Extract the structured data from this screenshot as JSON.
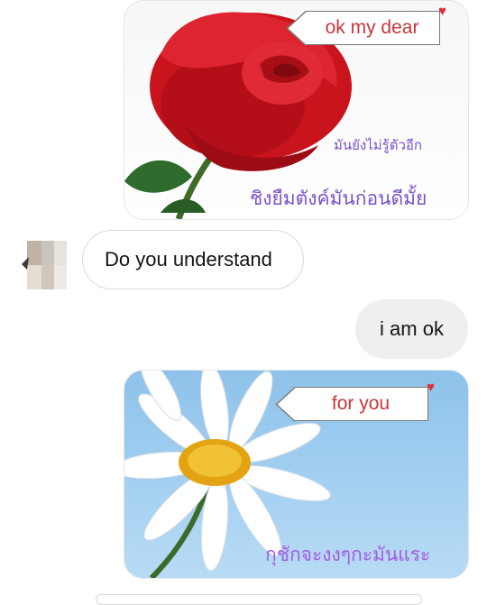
{
  "messages": [
    {
      "type": "sticker",
      "side": "outgoing",
      "image": "red-rose",
      "tag_text": "ok my dear",
      "caption_small": "มันยังไม่รู้ตัวอีก",
      "caption_large": "ชิงยืมตังค์มันก่อนดีมั้ย"
    },
    {
      "type": "text",
      "side": "incoming",
      "text": "Do you understand"
    },
    {
      "type": "text",
      "side": "outgoing",
      "text": "i am ok"
    },
    {
      "type": "sticker",
      "side": "outgoing",
      "image": "white-daisy",
      "tag_text": "for you",
      "caption_large": "กุชักจะงงๆกะมันแระ"
    }
  ],
  "colors": {
    "incoming_bubble": "#ffffff",
    "outgoing_bubble": "#efefef",
    "tag_text": "#c8363c",
    "thai_caption": "#7a4fc9",
    "heart": "#e0303c"
  }
}
